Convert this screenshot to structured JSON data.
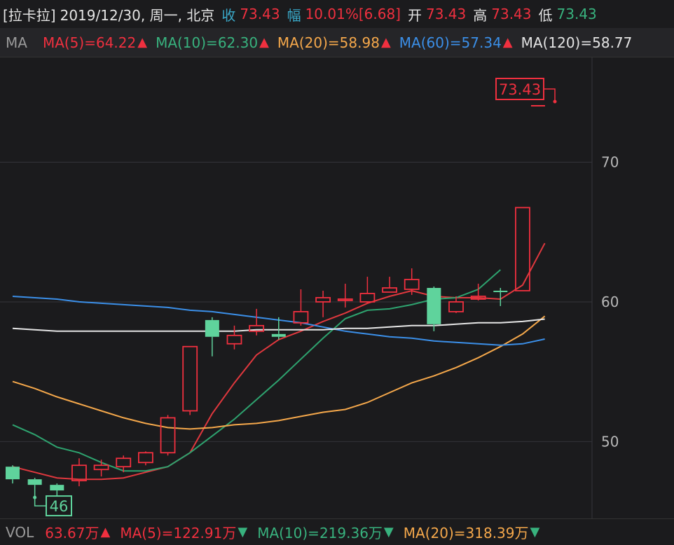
{
  "header": {
    "name": "[拉卡拉]",
    "date": "2019/12/30, 周一, 北京",
    "close_label": "收",
    "close_value": "73.43",
    "change_label": "幅",
    "change_pct": "10.01%",
    "change_amt": "[6.68]",
    "open_label": "开",
    "open_value": "73.43",
    "high_label": "高",
    "high_value": "73.43",
    "low_label": "低",
    "low_value": "73.43"
  },
  "ma_bar": {
    "label": "MA",
    "ma5": "MA(5)=64.22",
    "ma10": "MA(10)=62.30",
    "ma20": "MA(20)=58.98",
    "ma60": "MA(60)=57.34",
    "ma120": "MA(120)=58.77",
    "arrow_up": "▲"
  },
  "vol_bar": {
    "label": "VOL",
    "vol": "63.67万",
    "ma5": "MA(5)=122.91万",
    "ma10": "MA(10)=219.36万",
    "ma20": "MA(20)=318.39万",
    "arrow_up": "▲",
    "arrow_down": "▼"
  },
  "colors": {
    "up": "#f0303f",
    "down": "#5fd39c",
    "ma5": "#e0383e",
    "ma10": "#2ea36f",
    "ma20": "#f5a84b",
    "ma60": "#3b8fe8",
    "ma120": "#e6e6e6",
    "grid": "#34343a",
    "axis_text": "#b8b8b8"
  },
  "chart_data": {
    "type": "candlestick",
    "y_ticks": [
      "70",
      "60",
      "50"
    ],
    "ylim": [
      44.5,
      77.5
    ],
    "max_label": "73.43",
    "min_label": "46",
    "candles": [
      {
        "o": 48.2,
        "c": 47.3,
        "h": 48.3,
        "l": 47.0
      },
      {
        "o": 47.3,
        "c": 46.9,
        "h": 47.4,
        "l": 46.0
      },
      {
        "o": 46.9,
        "c": 46.5,
        "h": 47.0,
        "l": 46.1
      },
      {
        "o": 47.2,
        "c": 48.3,
        "h": 48.8,
        "l": 46.8
      },
      {
        "o": 48.0,
        "c": 48.3,
        "h": 48.7,
        "l": 47.5
      },
      {
        "o": 48.2,
        "c": 48.8,
        "h": 49.0,
        "l": 47.8
      },
      {
        "o": 48.5,
        "c": 49.2,
        "h": 49.3,
        "l": 48.3
      },
      {
        "o": 49.2,
        "c": 51.7,
        "h": 51.9,
        "l": 49.0
      },
      {
        "o": 52.2,
        "c": 56.8,
        "h": 56.8,
        "l": 51.9
      },
      {
        "o": 58.7,
        "c": 57.5,
        "h": 58.9,
        "l": 56.1
      },
      {
        "o": 57.0,
        "c": 57.6,
        "h": 58.3,
        "l": 56.6
      },
      {
        "o": 57.9,
        "c": 58.3,
        "h": 59.5,
        "l": 57.6
      },
      {
        "o": 57.7,
        "c": 57.5,
        "h": 58.9,
        "l": 57.3
      },
      {
        "o": 58.5,
        "c": 59.3,
        "h": 60.9,
        "l": 58.3
      },
      {
        "o": 60.0,
        "c": 60.3,
        "h": 60.8,
        "l": 58.9
      },
      {
        "o": 60.2,
        "c": 60.2,
        "h": 61.3,
        "l": 59.6
      },
      {
        "o": 60.0,
        "c": 60.6,
        "h": 61.8,
        "l": 59.9
      },
      {
        "o": 60.7,
        "c": 61.0,
        "h": 61.8,
        "l": 60.7
      },
      {
        "o": 60.9,
        "c": 61.6,
        "h": 62.4,
        "l": 60.5
      },
      {
        "o": 61.0,
        "c": 58.4,
        "h": 61.1,
        "l": 57.9
      },
      {
        "o": 59.3,
        "c": 60.0,
        "h": 60.4,
        "l": 59.2
      },
      {
        "o": 60.2,
        "c": 60.4,
        "h": 61.3,
        "l": 60.1
      },
      {
        "o": 60.8,
        "c": 60.7,
        "h": 61.0,
        "l": 59.7
      },
      {
        "o": 60.8,
        "c": 66.75,
        "h": 66.75,
        "l": 60.8
      }
    ],
    "series": [
      {
        "name": "MA(5)",
        "color_key": "ma5",
        "start": 0,
        "values": [
          48.2,
          47.8,
          47.4,
          47.3,
          47.3,
          47.4,
          47.8,
          48.2,
          49.2,
          52.0,
          54.2,
          56.2,
          57.3,
          57.9,
          58.6,
          59.2,
          59.9,
          60.4,
          60.8,
          60.4,
          60.3,
          60.3,
          60.2,
          61.2,
          64.2
        ]
      },
      {
        "name": "MA(10)",
        "color_key": "ma10",
        "start": 0,
        "values": [
          51.2,
          50.5,
          49.6,
          49.2,
          48.5,
          47.9,
          47.9,
          48.2,
          49.2,
          50.4,
          51.6,
          53.0,
          54.4,
          55.9,
          57.4,
          58.8,
          59.4,
          59.5,
          59.8,
          60.2,
          60.3,
          60.9,
          62.3
        ]
      },
      {
        "name": "MA(20)",
        "color_key": "ma20",
        "start": 0,
        "values": [
          54.3,
          53.8,
          53.2,
          52.7,
          52.2,
          51.7,
          51.3,
          51.0,
          50.9,
          51.0,
          51.2,
          51.3,
          51.5,
          51.8,
          52.1,
          52.3,
          52.8,
          53.5,
          54.2,
          54.7,
          55.3,
          56.0,
          56.8,
          57.7,
          58.98
        ]
      },
      {
        "name": "MA(60)",
        "color_key": "ma60",
        "start": 0,
        "values": [
          60.4,
          60.3,
          60.2,
          60.0,
          59.9,
          59.8,
          59.7,
          59.6,
          59.4,
          59.3,
          59.1,
          58.9,
          58.7,
          58.5,
          58.2,
          57.9,
          57.7,
          57.5,
          57.4,
          57.2,
          57.1,
          57.0,
          56.9,
          57.0,
          57.34
        ]
      },
      {
        "name": "MA(120)",
        "color_key": "ma120",
        "start": 0,
        "values": [
          58.1,
          58.0,
          57.9,
          57.9,
          57.9,
          57.9,
          57.9,
          57.9,
          57.9,
          57.9,
          57.9,
          58.0,
          58.0,
          58.0,
          58.0,
          58.1,
          58.1,
          58.2,
          58.3,
          58.3,
          58.4,
          58.5,
          58.5,
          58.6,
          58.77
        ]
      }
    ]
  }
}
